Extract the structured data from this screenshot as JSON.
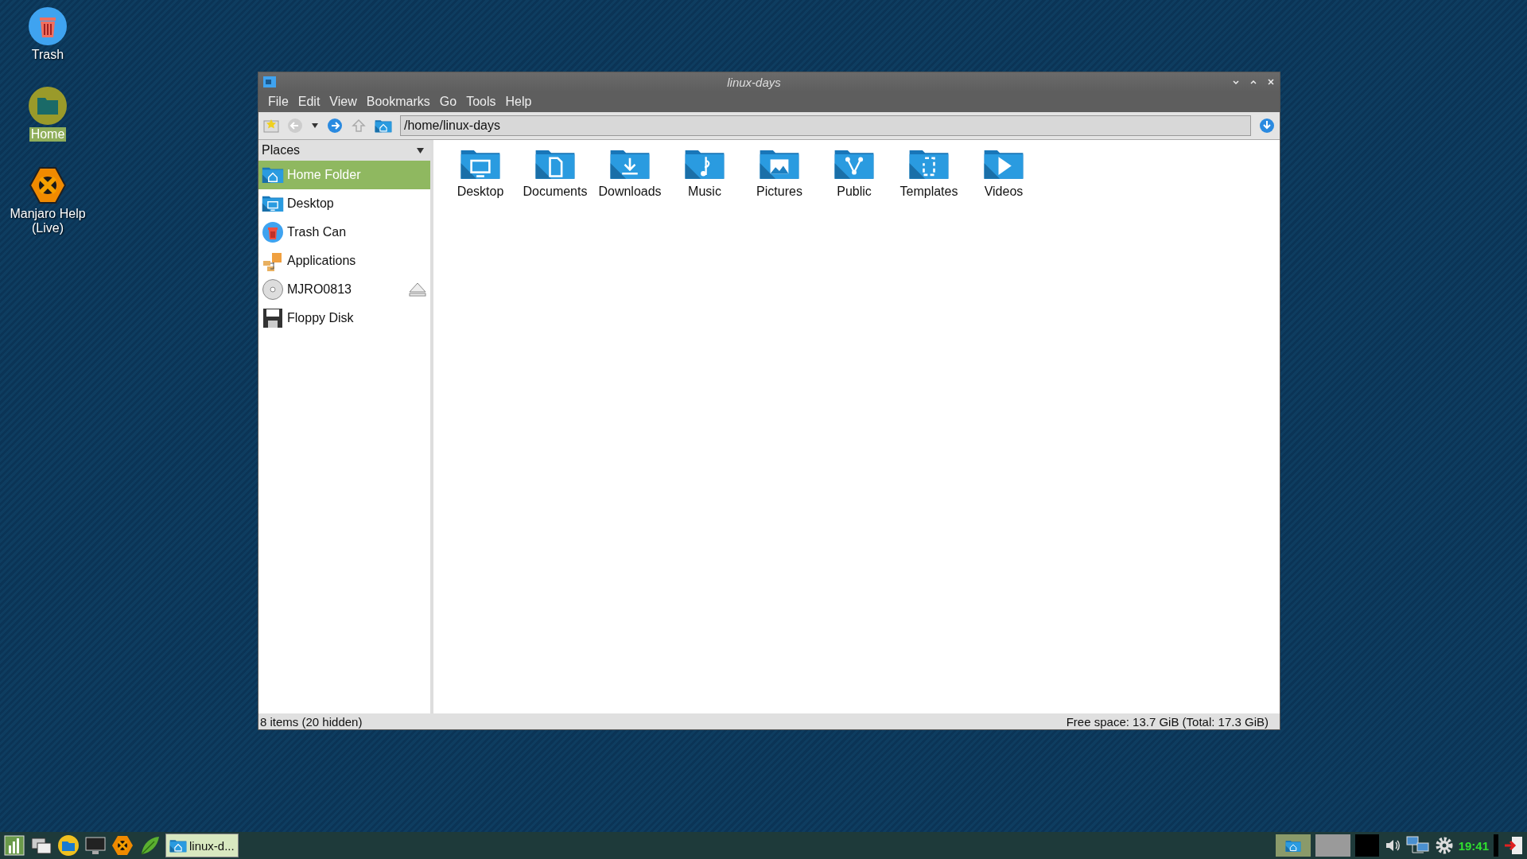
{
  "desktop_icons": [
    {
      "label": "Trash",
      "kind": "trash",
      "selected": false
    },
    {
      "label": "Home",
      "kind": "folder",
      "selected": true
    },
    {
      "label": "Manjaro Help (Live)",
      "kind": "help",
      "selected": false
    }
  ],
  "window": {
    "title": "linux-days",
    "menu": [
      "File",
      "Edit",
      "View",
      "Bookmarks",
      "Go",
      "Tools",
      "Help"
    ],
    "path": "/home/linux-days",
    "sidebar": {
      "header": "Places",
      "items": [
        {
          "label": "Home Folder",
          "kind": "home",
          "selected": true,
          "ejectable": false
        },
        {
          "label": "Desktop",
          "kind": "desktop",
          "selected": false,
          "ejectable": false
        },
        {
          "label": "Trash Can",
          "kind": "trash",
          "selected": false,
          "ejectable": false
        },
        {
          "label": "Applications",
          "kind": "apps",
          "selected": false,
          "ejectable": false
        },
        {
          "label": "MJRO0813",
          "kind": "disc",
          "selected": false,
          "ejectable": true
        },
        {
          "label": "Floppy Disk",
          "kind": "floppy",
          "selected": false,
          "ejectable": false
        }
      ]
    },
    "folders": [
      {
        "label": "Desktop",
        "kind": "desktop"
      },
      {
        "label": "Documents",
        "kind": "documents"
      },
      {
        "label": "Downloads",
        "kind": "downloads"
      },
      {
        "label": "Music",
        "kind": "music"
      },
      {
        "label": "Pictures",
        "kind": "pictures"
      },
      {
        "label": "Public",
        "kind": "public"
      },
      {
        "label": "Templates",
        "kind": "templates"
      },
      {
        "label": "Videos",
        "kind": "videos"
      }
    ],
    "status_bar": {
      "left": "8 items (20 hidden)",
      "right": "Free space: 13.7 GiB (Total: 17.3 GiB)"
    }
  },
  "taskbar": {
    "launchers": [
      {
        "kind": "menu"
      },
      {
        "kind": "windows"
      },
      {
        "kind": "files"
      },
      {
        "kind": "terminal"
      },
      {
        "kind": "help"
      },
      {
        "kind": "leaf"
      }
    ],
    "task": {
      "label": "linux-d...",
      "selected": true
    },
    "clock": "19:41"
  }
}
